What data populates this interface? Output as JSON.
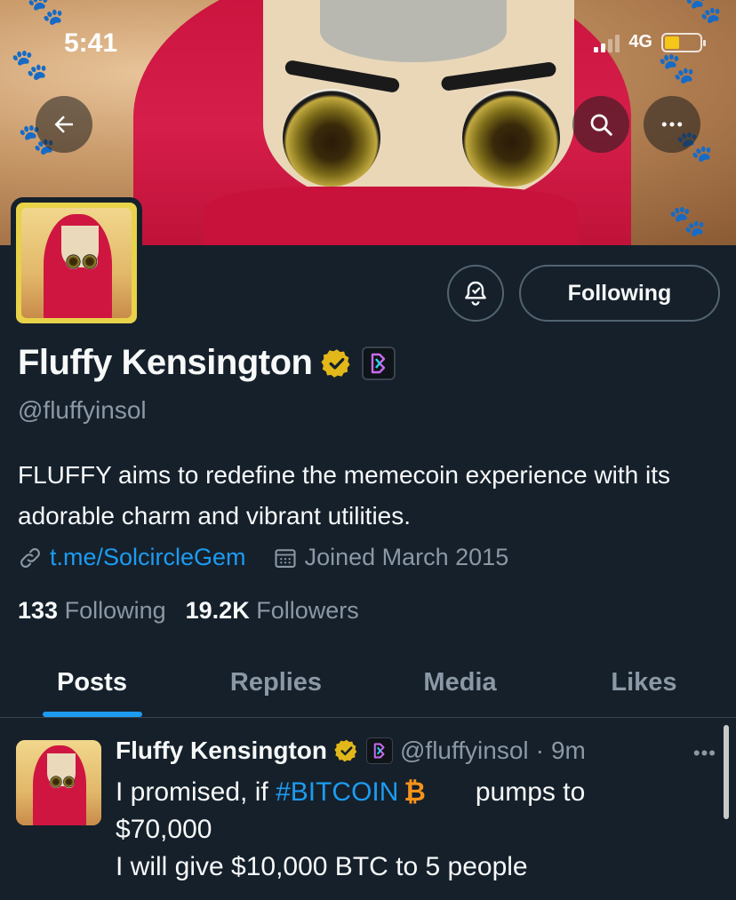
{
  "status_bar": {
    "time": "5:41",
    "network": "4G"
  },
  "header": {
    "back_label": "Back",
    "search_label": "Search",
    "more_label": "More"
  },
  "profile": {
    "name": "Fluffy Kensington",
    "handle": "@fluffyinsol",
    "bio": "FLUFFY aims to redefine the memecoin experience with its adorable charm and vibrant utilities.",
    "link": "t.me/SolcircleGem",
    "joined": "Joined March 2015",
    "following_count": "133",
    "following_label": "Following",
    "followers_count": "19.2K",
    "followers_label": "Followers",
    "follow_button": "Following"
  },
  "tabs": [
    {
      "label": "Posts",
      "active": true
    },
    {
      "label": "Replies",
      "active": false
    },
    {
      "label": "Media",
      "active": false
    },
    {
      "label": "Likes",
      "active": false
    }
  ],
  "post": {
    "name": "Fluffy Kensington",
    "handle": "@fluffyinsol",
    "separator": "·",
    "time": "9m",
    "more": "•••",
    "text_before": "I promised, if ",
    "hashtag": "#BITCOIN",
    "bitcoin_symbol": "₿",
    "text_after": "pumps to",
    "line2": "$70,000",
    "line3": "I will give $10,000 BTC to 5 people"
  },
  "colors": {
    "background": "#15202b",
    "accent": "#1d9bf0",
    "muted": "#8b98a5",
    "verified": "#e2b719",
    "bitcoin": "#f7931a"
  },
  "icons": [
    "back-arrow-icon",
    "search-icon",
    "more-icon",
    "notification-bell-icon",
    "verified-badge-icon",
    "affiliate-badge-icon",
    "link-icon",
    "calendar-icon"
  ]
}
